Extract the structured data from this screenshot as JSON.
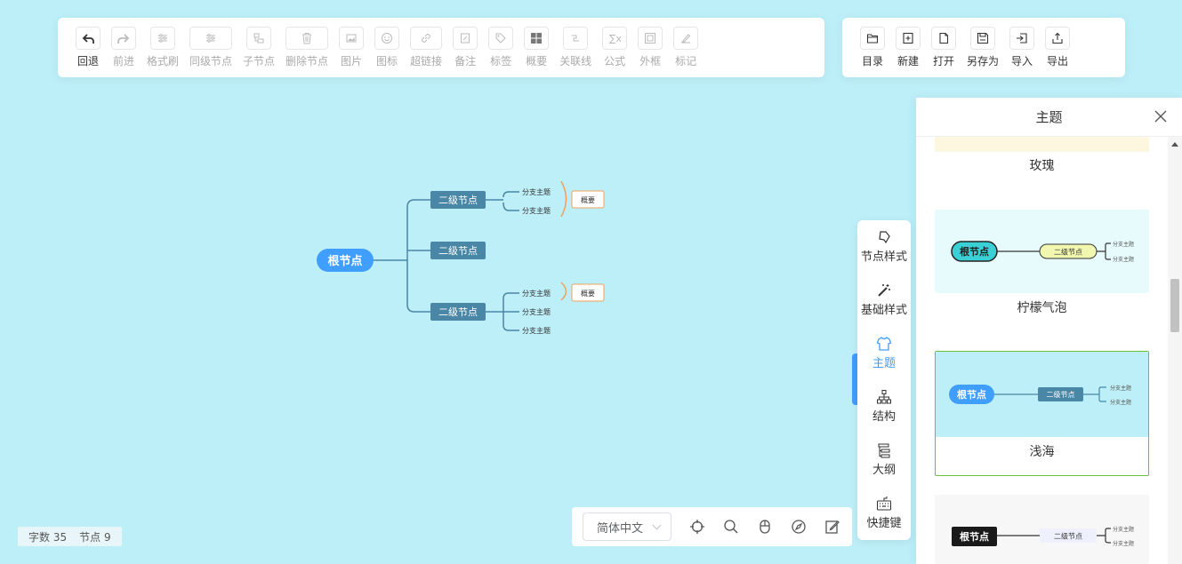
{
  "toolbar_left": [
    {
      "label": "回退",
      "icon": "undo-icon",
      "active": true
    },
    {
      "label": "前进",
      "icon": "redo-icon",
      "active": false
    },
    {
      "label": "格式刷",
      "icon": "format-brush-icon",
      "active": false
    },
    {
      "label": "同级节点",
      "icon": "sibling-node-icon",
      "active": false
    },
    {
      "label": "子节点",
      "icon": "child-node-icon",
      "active": false
    },
    {
      "label": "删除节点",
      "icon": "trash-icon",
      "active": false
    },
    {
      "label": "图片",
      "icon": "image-icon",
      "active": false
    },
    {
      "label": "图标",
      "icon": "smiley-icon",
      "active": false
    },
    {
      "label": "超链接",
      "icon": "link-icon",
      "active": false
    },
    {
      "label": "备注",
      "icon": "note-icon",
      "active": false
    },
    {
      "label": "标签",
      "icon": "tag-icon",
      "active": false
    },
    {
      "label": "概要",
      "icon": "summary-icon",
      "active": false
    },
    {
      "label": "关联线",
      "icon": "association-line-icon",
      "active": false
    },
    {
      "label": "公式",
      "icon": "formula-icon",
      "active": false
    },
    {
      "label": "外框",
      "icon": "outer-frame-icon",
      "active": false
    },
    {
      "label": "标记",
      "icon": "mark-icon",
      "active": false
    }
  ],
  "toolbar_right": [
    {
      "label": "目录",
      "icon": "folder-icon"
    },
    {
      "label": "新建",
      "icon": "new-file-icon"
    },
    {
      "label": "打开",
      "icon": "open-file-icon"
    },
    {
      "label": "另存为",
      "icon": "save-as-icon"
    },
    {
      "label": "导入",
      "icon": "import-icon"
    },
    {
      "label": "导出",
      "icon": "export-icon"
    }
  ],
  "mindmap": {
    "root": "根节点",
    "level2": [
      "二级节点",
      "二级节点",
      "二级节点"
    ],
    "branch": "分支主题",
    "summary": "概要"
  },
  "side_tabs": [
    {
      "label": "节点样式",
      "icon": "node-style-icon"
    },
    {
      "label": "基础样式",
      "icon": "magic-wand-icon"
    },
    {
      "label": "主题",
      "icon": "shirt-icon",
      "active": true
    },
    {
      "label": "结构",
      "icon": "structure-icon"
    },
    {
      "label": "大纲",
      "icon": "outline-icon"
    },
    {
      "label": "快捷键",
      "icon": "keyboard-icon"
    }
  ],
  "panel": {
    "title": "主题",
    "themes": [
      {
        "name": "玫瑰"
      },
      {
        "name": "柠檬气泡",
        "root": "根节点",
        "second": "二级节点",
        "branch": "分支主题"
      },
      {
        "name": "浅海",
        "root": "根节点",
        "second": "二级节点",
        "branch": "分支主题",
        "selected": true
      },
      {
        "name": "",
        "root": "根节点",
        "second": "二级节点",
        "branch": "分支主题"
      }
    ]
  },
  "bottom": {
    "language": "简体中文"
  },
  "counts": {
    "words_label": "字数",
    "words": "35",
    "nodes_label": "节点",
    "nodes": "9"
  },
  "colors": {
    "canvas_bg": "#bdeff8",
    "root_fill": "#409eff",
    "level2_fill": "#4a86a5",
    "summary_stroke": "#f0a058",
    "accent": "#409eff"
  }
}
